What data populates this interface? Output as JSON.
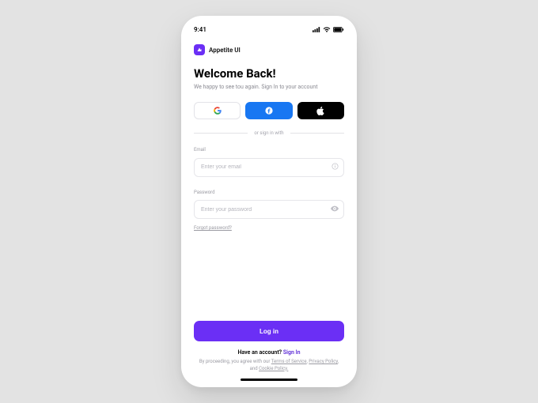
{
  "status": {
    "time": "9:41"
  },
  "brand": {
    "name": "Appetite UI"
  },
  "headline": "Welcome Back!",
  "subhead": "We happy to see tou again. Sign In to your account",
  "divider": "or sign in with",
  "emailField": {
    "label": "Email",
    "placeholder": "Enter your email"
  },
  "passwordField": {
    "label": "Password",
    "placeholder": "Enter your password"
  },
  "forgot": "Forgot password?",
  "primaryCta": "Log in",
  "footer": {
    "havePrefix": "Have an account? ",
    "signIn": "Sign In",
    "legalPrefix": "By proceeding, you agree with our ",
    "terms": "Terms of Service",
    "sep1": ", ",
    "privacy": "Privacy Policy",
    "sep2": ", and ",
    "cookie": "Cookie Policy.",
    "suffix": ""
  },
  "colors": {
    "accent": "#6b2ff5",
    "fb": "#1877f2"
  }
}
